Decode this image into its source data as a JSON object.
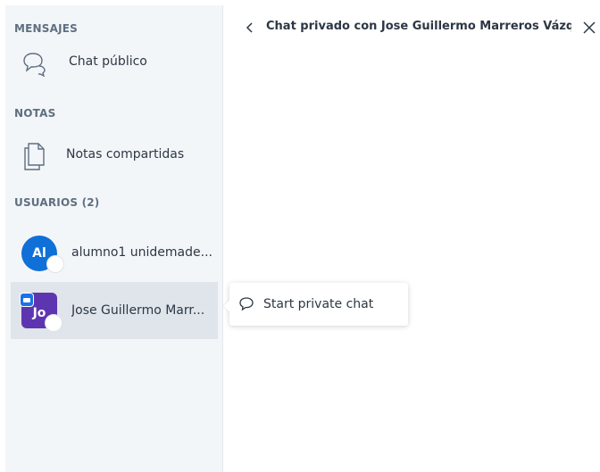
{
  "sidebar": {
    "messages_title": "MENSAJES",
    "public_chat_label": "Chat público",
    "notes_title": "NOTAS",
    "shared_notes_label": "Notas compartidas",
    "users_title": "USUARIOS (2)",
    "users": [
      {
        "initials": "Al",
        "name": "alumno1 unidemade...",
        "avatar_color": "#0f70d7",
        "shape": "circle"
      },
      {
        "initials": "Jo",
        "name": "Jose Guillermo Marr...",
        "avatar_color": "#5e35b1",
        "shape": "square",
        "active": true
      }
    ]
  },
  "popover": {
    "label": "Start private chat",
    "icon": "chat-bubble-icon"
  },
  "chat": {
    "title": "Chat privado con Jose Guillermo Marreros Vázquez",
    "back_icon": "chevron-left-icon",
    "close_icon": "close-icon"
  }
}
